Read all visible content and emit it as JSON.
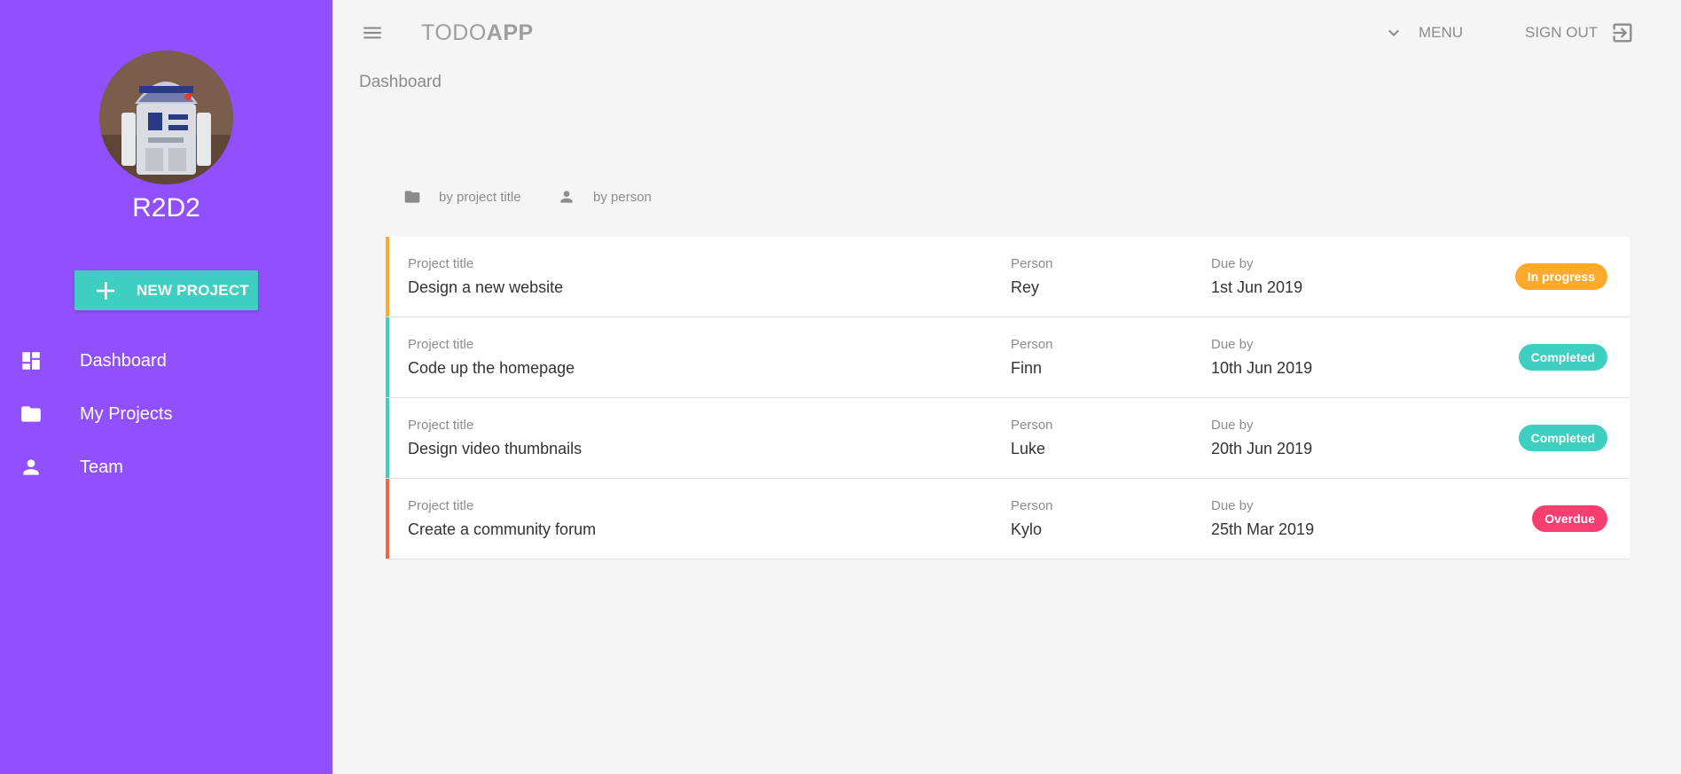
{
  "user": {
    "name": "R2D2"
  },
  "sidebar": {
    "new_project_label": "NEW PROJECT",
    "items": [
      {
        "label": "Dashboard",
        "icon": "dashboard-icon"
      },
      {
        "label": "My Projects",
        "icon": "folder-icon"
      },
      {
        "label": "Team",
        "icon": "person-icon"
      }
    ]
  },
  "topbar": {
    "brand_light": "TODO",
    "brand_bold": "APP",
    "menu_label": "MENU",
    "signout_label": "SIGN OUT"
  },
  "page": {
    "title": "Dashboard"
  },
  "sort": {
    "by_title": "by project title",
    "by_person": "by person"
  },
  "columns": {
    "title": "Project title",
    "person": "Person",
    "due": "Due by"
  },
  "projects": [
    {
      "title": "Design a new website",
      "person": "Rey",
      "due": "1st Jun 2019",
      "status": "In progress",
      "color": "#ffaa2c"
    },
    {
      "title": "Code up the homepage",
      "person": "Finn",
      "due": "10th Jun 2019",
      "status": "Completed",
      "color": "#3ecfc1"
    },
    {
      "title": "Design video thumbnails",
      "person": "Luke",
      "due": "20th Jun 2019",
      "status": "Completed",
      "color": "#3ecfc1"
    },
    {
      "title": "Create a community forum",
      "person": "Kylo",
      "due": "25th Mar 2019",
      "status": "Overdue",
      "color": "#f83e70"
    }
  ],
  "colors": {
    "sidebar": "#9150fe",
    "accent": "#3ecfc1",
    "in_progress": "#ffaa2c",
    "completed": "#3ecfc1",
    "overdue": "#f83e70",
    "overdue_border": "#f06543"
  }
}
